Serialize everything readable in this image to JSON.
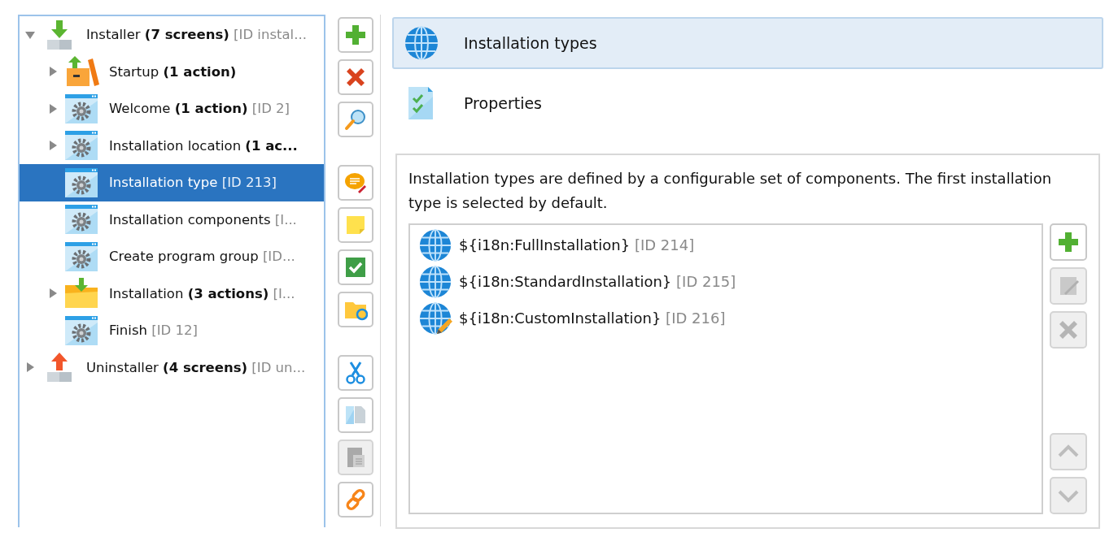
{
  "tree": {
    "focused": true,
    "items": [
      {
        "kind": "installer",
        "name": "Installer",
        "detail": "(7 screens)",
        "id": "[ID instal...",
        "expanded": true,
        "selected": false,
        "children": [
          {
            "kind": "startup",
            "name": "Startup",
            "detail": "(1 action)",
            "expanded": false,
            "selected": false,
            "has_children": true
          },
          {
            "kind": "screen",
            "name": "Welcome",
            "detail": "(1 action)",
            "id": "[ID 2]",
            "expanded": false,
            "selected": false,
            "has_children": true
          },
          {
            "kind": "screen",
            "name": "Installation location",
            "detail": "(1 ac...",
            "expanded": false,
            "selected": false,
            "has_children": true
          },
          {
            "kind": "screen",
            "name": "Installation type",
            "id": "[ID 213]",
            "selected": true
          },
          {
            "kind": "screen",
            "name": "Installation components",
            "id": "[I...",
            "selected": false
          },
          {
            "kind": "screen",
            "name": "Create program group",
            "id": "[ID...",
            "selected": false
          },
          {
            "kind": "folder",
            "name": "Installation",
            "detail": "(3 actions)",
            "id": "[I...",
            "expanded": false,
            "selected": false,
            "has_children": true
          },
          {
            "kind": "screen",
            "name": "Finish",
            "id": "[ID 12]",
            "selected": false
          }
        ]
      },
      {
        "kind": "uninstaller",
        "name": "Uninstaller",
        "detail": "(4 screens)",
        "id": "[ID un...",
        "expanded": false,
        "selected": false,
        "has_children": true
      }
    ]
  },
  "toolbar": [
    {
      "kind": "add",
      "disabled": false
    },
    {
      "kind": "delete",
      "disabled": false
    },
    {
      "kind": "find",
      "disabled": false
    },
    {
      "kind": "sep"
    },
    {
      "kind": "comment",
      "disabled": false
    },
    {
      "kind": "note",
      "disabled": false
    },
    {
      "kind": "check",
      "disabled": false
    },
    {
      "kind": "folder",
      "disabled": false
    },
    {
      "kind": "sep"
    },
    {
      "kind": "cut",
      "disabled": false
    },
    {
      "kind": "copy",
      "disabled": false
    },
    {
      "kind": "paste",
      "disabled": true
    },
    {
      "kind": "link",
      "disabled": false
    }
  ],
  "nav": [
    {
      "kind": "globe",
      "label": "Installation types",
      "selected": true
    },
    {
      "kind": "properties",
      "label": "Properties",
      "selected": false
    }
  ],
  "panel": {
    "description": "Installation types are defined by a configurable set of components. The first installation type is selected by default.",
    "types": [
      {
        "kind": "globe",
        "name": "${i18n:FullInstallation}",
        "id": "[ID 214]",
        "selected": false
      },
      {
        "kind": "globe",
        "name": "${i18n:StandardInstallation}",
        "id": "[ID 215]",
        "selected": false
      },
      {
        "kind": "globe-edit",
        "name": "${i18n:CustomInstallation}",
        "id": "[ID 216]",
        "selected": false
      }
    ],
    "buttons": [
      {
        "kind": "add",
        "disabled": false
      },
      {
        "kind": "edit",
        "disabled": true
      },
      {
        "kind": "delete",
        "disabled": true
      },
      {
        "kind": "sep"
      },
      {
        "kind": "up",
        "disabled": true
      },
      {
        "kind": "down",
        "disabled": true
      }
    ]
  }
}
